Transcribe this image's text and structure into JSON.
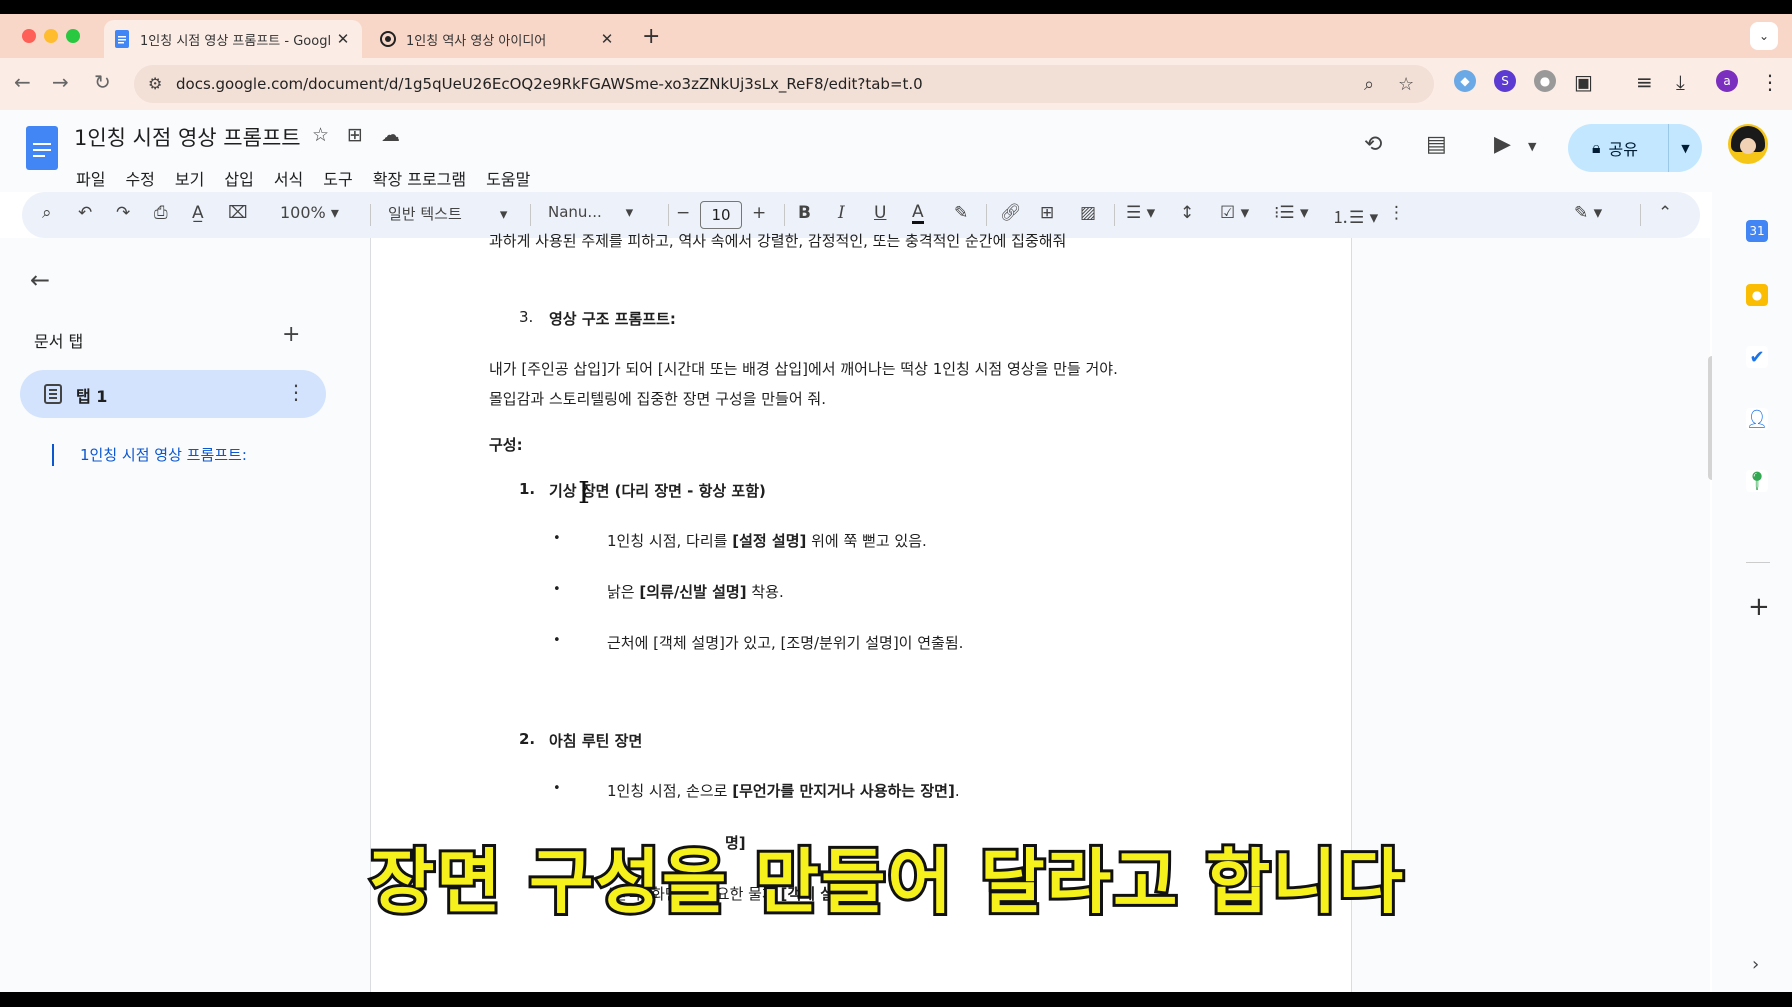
{
  "browser": {
    "tabs": [
      {
        "title": "1인칭 시점 영상 프롬프트 - Googl",
        "close": "✕"
      },
      {
        "title": "1인칭 역사 영상 아이디어",
        "close": "✕"
      }
    ],
    "new_tab": "+",
    "url": "docs.google.com/document/d/1g5qUeU26EcOQ2e9RkFGAWSme-xo3zZNkUj3sLx_ReF8/edit?tab=t.0",
    "profile_initial": "a"
  },
  "docs": {
    "title": "1인칭 시점 영상 프롬프트",
    "menu": [
      "파일",
      "수정",
      "보기",
      "삽입",
      "서식",
      "도구",
      "확장 프로그램",
      "도움말"
    ],
    "share_label": "공유"
  },
  "toolbar": {
    "zoom": "100%",
    "style": "일반 텍스트",
    "font": "Nanu...",
    "font_size": "10",
    "minus": "−",
    "plus": "+",
    "bold": "B",
    "italic": "I",
    "underline": "U",
    "text_color": "A"
  },
  "sidebar": {
    "section_label": "문서 탭",
    "add": "+",
    "tab_label": "탭 1",
    "outline_item": "1인칭 시점 영상 프롬프트:"
  },
  "document": {
    "intro": "과하게 사용된 주제를 피하고, 역사 속에서 강렬한, 감정적인, 또는 충격적인 순간에 집중해줘",
    "sec3_num": "3.",
    "sec3_title": "영상 구조 프롬프트:",
    "para1": "내가 [주인공 삽입]가 되어 [시간대 또는 배경 삽입]에서 깨어나는 떡상 1인칭 시점 영상을 만들 거야.",
    "para2": "몰입감과 스토리텔링에 집중한 장면 구성을 만들어 줘.",
    "composition": "구성:",
    "item1_num": "1.",
    "item1_title": "기상 장면 (다리 장면 - 항상 포함)",
    "item1_bullets": [
      {
        "pre": "1인칭 시점, 다리를 ",
        "bold": "[설정 설명]",
        "post": " 위에 쭉 뻗고 있음."
      },
      {
        "pre": "낡은 ",
        "bold": "[의류/신발 설명]",
        "post": " 착용."
      },
      {
        "pre": "근처에 [객체 설명]가 있고, [조명/분위기 설명]이 연출됨.",
        "bold": "",
        "post": ""
      }
    ],
    "item2_num": "2.",
    "item2_title": "아침 루틴 장면",
    "item2_bullets": [
      {
        "pre": "1인칭 시점, 손으로 ",
        "bold": "[무언가를 만지거나 사용하는 장면]",
        "post": "."
      },
      {
        "pre": "",
        "bold": "명]",
        "post": ""
      },
      {
        "pre": "(선택) 화면 속 중요한 물체 ",
        "bold": "[객체 설명]",
        "post": "."
      }
    ],
    "bullet_char": "•"
  },
  "caption": "장면 구성을 만들어 달라고 합니다",
  "colors": {
    "tabstrip": "#f8d7c9",
    "docs_blue": "#4285f4",
    "share_bg": "#c2e7ff",
    "tab_active_bg": "#d3e3fd",
    "outline_blue": "#0b57d0",
    "caption_fill": "#f6f01c"
  }
}
